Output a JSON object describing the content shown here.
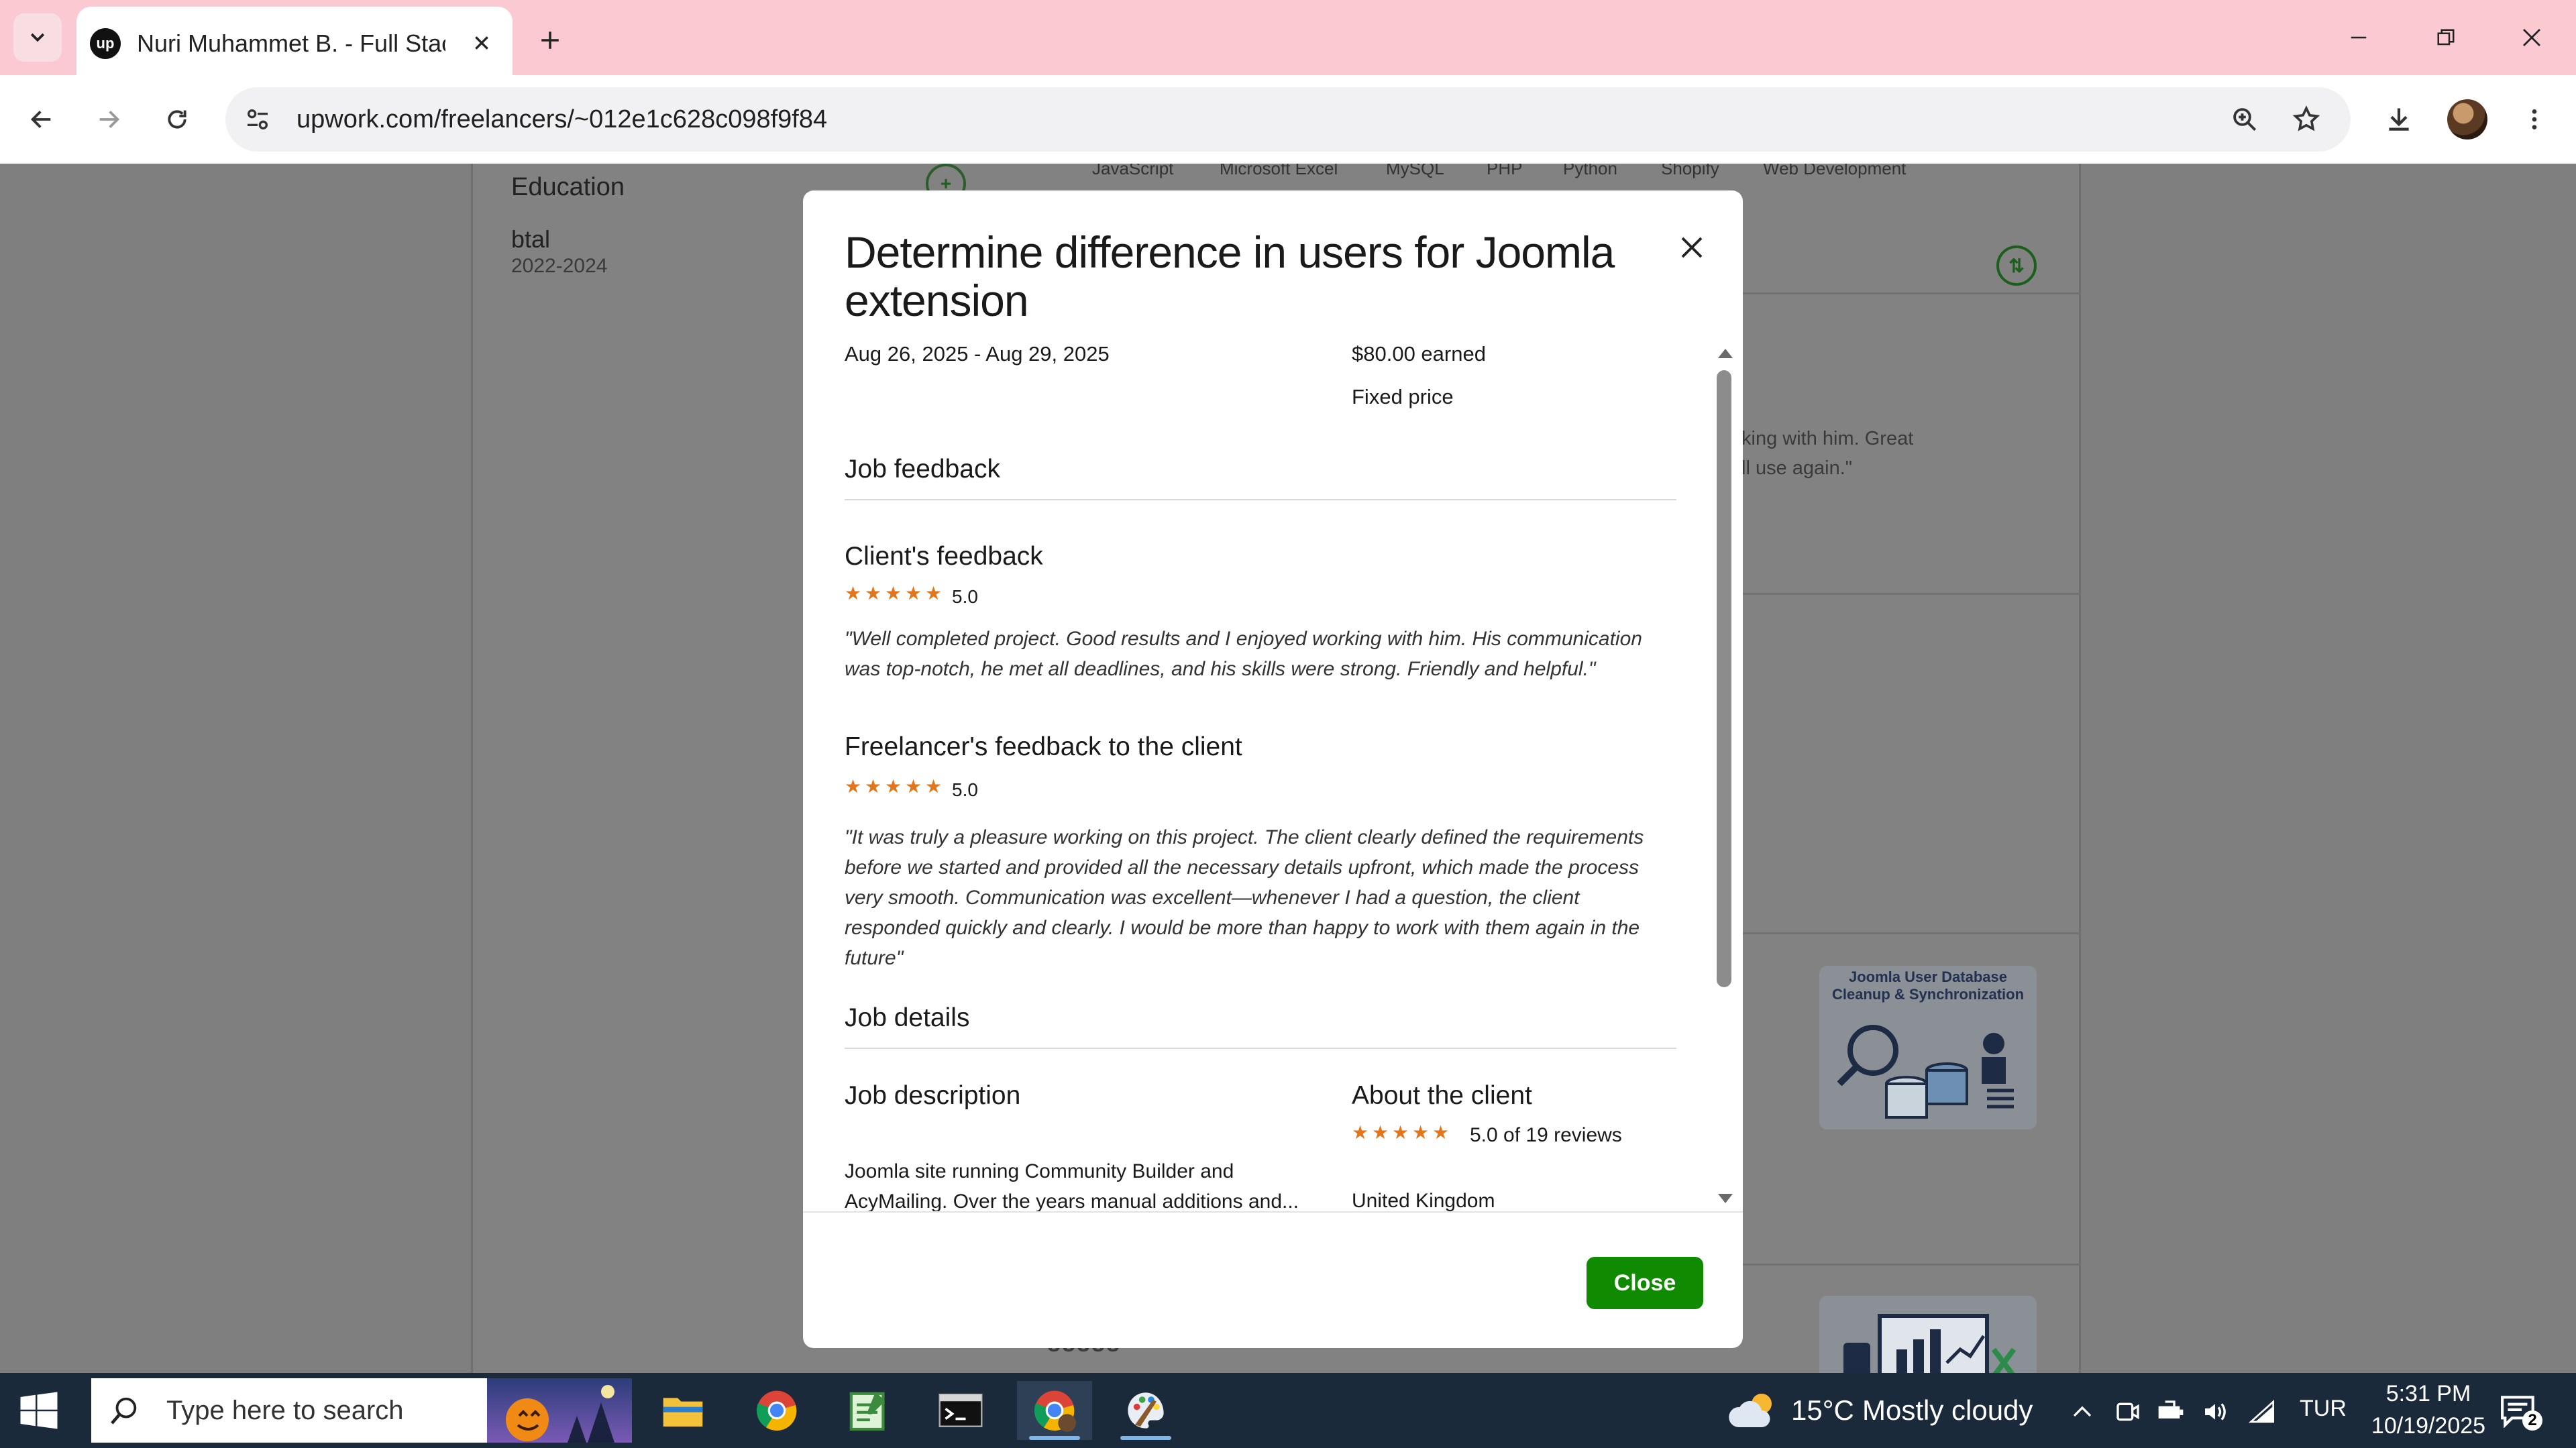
{
  "browser": {
    "tab_title": "Nuri Muhammet B. - Full Stack",
    "tab_favicon_text": "up",
    "url": "upwork.com/freelancers/~012e1c628c098f9f84"
  },
  "background_page": {
    "education_heading": "Education",
    "school_name": "btal",
    "school_years": "2022-2024",
    "skills": [
      "JavaScript",
      "Microsoft Excel",
      "MySQL",
      "PHP",
      "Python",
      "Shopify",
      "Web Development"
    ],
    "review_snippet_line1": "king with him. Great",
    "review_snippet_line2": "ll use again.\"",
    "thumb1_title_line1": "Joomla User Database",
    "thumb1_title_line2": "Cleanup & Synchronization",
    "partial_bottom_text": "ooooo"
  },
  "modal": {
    "title": "Determine difference in users for Joomla extension",
    "dates": "Aug 26, 2025 - Aug 29, 2025",
    "earned": "$80.00 earned",
    "price_type": "Fixed price",
    "job_feedback_heading": "Job feedback",
    "client_feedback_heading": "Client's feedback",
    "client_rating": "5.0",
    "client_stars": 5,
    "client_quote": "\"Well completed project. Good results and I enjoyed working with him. His communication was top-notch, he met all deadlines, and his skills were strong. Friendly and helpful.\"",
    "freelancer_feedback_heading": "Freelancer's feedback to the client",
    "freelancer_rating": "5.0",
    "freelancer_stars": 5,
    "freelancer_quote": "\"It was truly a pleasure working on this project. The client clearly defined the requirements before we started and provided all the necessary details upfront, which made the process very smooth. Communication was excellent—whenever I had a question, the client responded quickly and clearly. I would be more than happy to work with them again in the future\"",
    "job_details_heading": "Job details",
    "job_description_heading": "Job description",
    "job_description_line1": "Joomla site running Community Builder and",
    "job_description_line2": "AcyMailing. Over the years manual additions and...",
    "about_client_heading": "About the client",
    "client_reviews": "5.0 of 19 reviews",
    "client_country": "United Kingdom",
    "close_label": "Close"
  },
  "taskbar": {
    "search_placeholder": "Type here to search",
    "weather_temp": "15°C",
    "weather_desc": "Mostly cloudy",
    "language": "TUR",
    "time": "5:31 PM",
    "date": "10/19/2025",
    "notification_count": "2"
  },
  "colors": {
    "accent_green": "#108a00",
    "star_orange": "#e3761a",
    "tabstrip_pink": "#fbc9d2"
  }
}
